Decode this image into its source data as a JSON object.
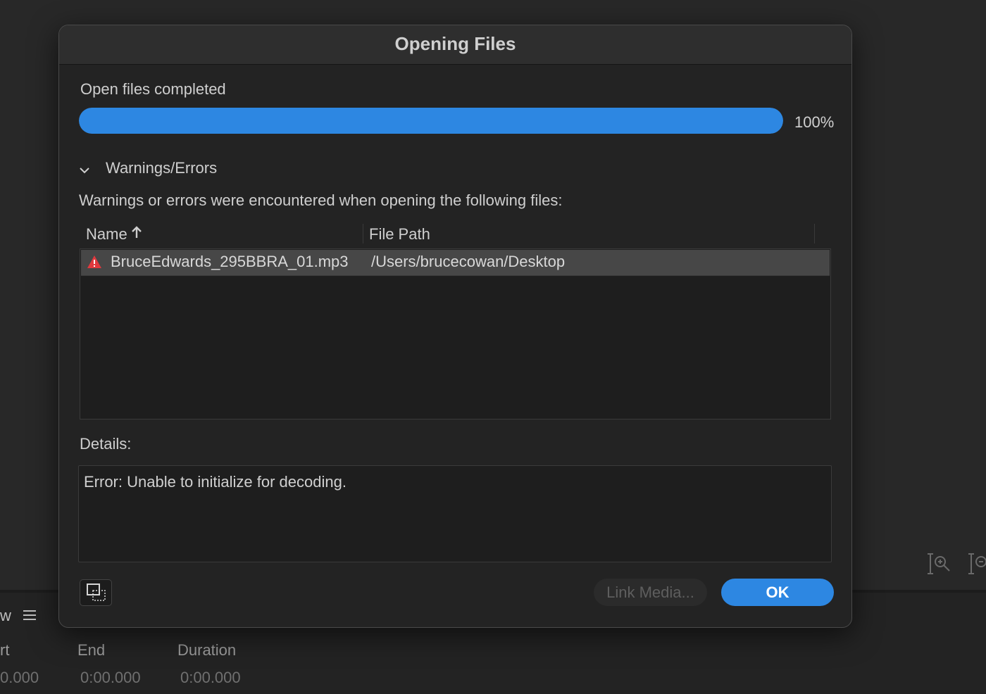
{
  "background": {
    "panel_title_fragment": "w",
    "menu_icon": "hamburger-icon",
    "columns": {
      "start": "rt",
      "end": "End",
      "duration": "Duration"
    },
    "values": {
      "start": "0.000",
      "end": "0:00.000",
      "duration": "0:00.000"
    },
    "zoom_icons": [
      "zoom-vertical-in-icon",
      "zoom-vertical-out-icon"
    ]
  },
  "dialog": {
    "title": "Opening Files",
    "status_text": "Open files completed",
    "progress": {
      "value": 100,
      "label": "100%"
    },
    "section": {
      "title": "Warnings/Errors",
      "expanded": true
    },
    "message": "Warnings or errors were encountered when opening the following files:",
    "table": {
      "columns": [
        {
          "label": "Name",
          "sort": "ascending",
          "sort_icon": "arrow-up-icon"
        },
        {
          "label": "File Path"
        }
      ],
      "rows": [
        {
          "icon": "warning-triangle-icon",
          "name": "BruceEdwards_295BBRA_01.mp3",
          "path": "/Users/brucecowan/Desktop",
          "selected": true
        }
      ]
    },
    "details_label": "Details:",
    "details_text": "Error: Unable to initialize for decoding.",
    "buttons": {
      "icon_button": "select-region-icon",
      "link_media": "Link Media...",
      "ok": "OK"
    },
    "colors": {
      "accent": "#2d87e2",
      "warning": "#e0393e"
    }
  }
}
